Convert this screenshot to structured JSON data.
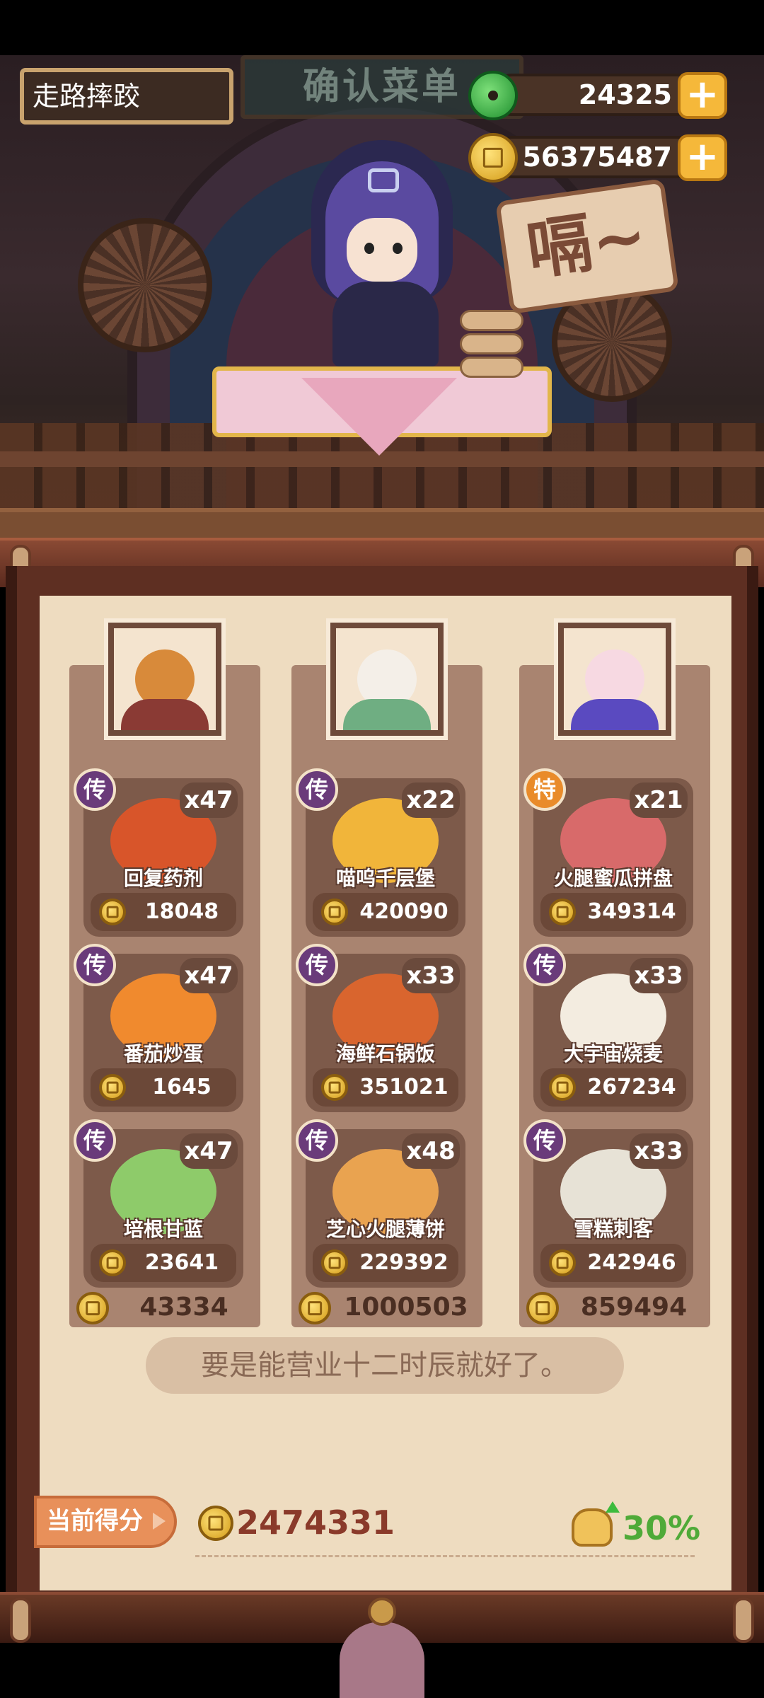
{
  "scene": {
    "signboard": "确认菜单",
    "speech": "嗝~"
  },
  "player": {
    "name": "走路摔跤"
  },
  "currencies": {
    "jade": {
      "icon": "jade-icon",
      "amount": "24325",
      "add_label": "+"
    },
    "coin": {
      "icon": "coin-icon",
      "amount": "56375487",
      "add_label": "+"
    }
  },
  "customers": [
    {
      "portrait": "bear-customer-portrait",
      "portrait_colors": {
        "face": "#d88a3a",
        "body": "#8a3a34"
      },
      "dishes": [
        {
          "rarity": "传",
          "rarity_type": "legend",
          "count": "x47",
          "name": "回复药剂",
          "price": "18048",
          "art_color": "#d8552a"
        },
        {
          "rarity": "传",
          "rarity_type": "legend",
          "count": "x47",
          "name": "番茄炒蛋",
          "price": "1645",
          "art_color": "#f08a2e"
        },
        {
          "rarity": "传",
          "rarity_type": "legend",
          "count": "x47",
          "name": "培根甘蓝",
          "price": "23641",
          "art_color": "#8ecb6a"
        }
      ],
      "total": "43334"
    },
    {
      "portrait": "white-hair-customer-portrait",
      "portrait_colors": {
        "face": "#f4efe8",
        "body": "#6fae82"
      },
      "dishes": [
        {
          "rarity": "传",
          "rarity_type": "legend",
          "count": "x22",
          "name": "喵呜千层堡",
          "price": "420090",
          "art_color": "#f1b53a"
        },
        {
          "rarity": "传",
          "rarity_type": "legend",
          "count": "x33",
          "name": "海鲜石锅饭",
          "price": "351021",
          "art_color": "#d9652e"
        },
        {
          "rarity": "传",
          "rarity_type": "legend",
          "count": "x48",
          "name": "芝心火腿薄饼",
          "price": "229392",
          "art_color": "#e9a350"
        }
      ],
      "total": "1000503"
    },
    {
      "portrait": "purple-hair-customer-portrait",
      "portrait_colors": {
        "face": "#f7d9e2",
        "body": "#5a4ac0"
      },
      "dishes": [
        {
          "rarity": "特",
          "rarity_type": "special",
          "count": "x21",
          "name": "火腿蜜瓜拼盘",
          "price": "349314",
          "art_color": "#d86a6a"
        },
        {
          "rarity": "传",
          "rarity_type": "legend",
          "count": "x33",
          "name": "大宇宙烧麦",
          "price": "267234",
          "art_color": "#f3ece0"
        },
        {
          "rarity": "传",
          "rarity_type": "legend",
          "count": "x33",
          "name": "雪糕刺客",
          "price": "242946",
          "art_color": "#e7e2d6"
        }
      ],
      "total": "859494"
    }
  ],
  "message": "要是能营业十二时辰就好了。",
  "score": {
    "label": "当前得分",
    "value": "2474331",
    "bonus": "30%"
  }
}
